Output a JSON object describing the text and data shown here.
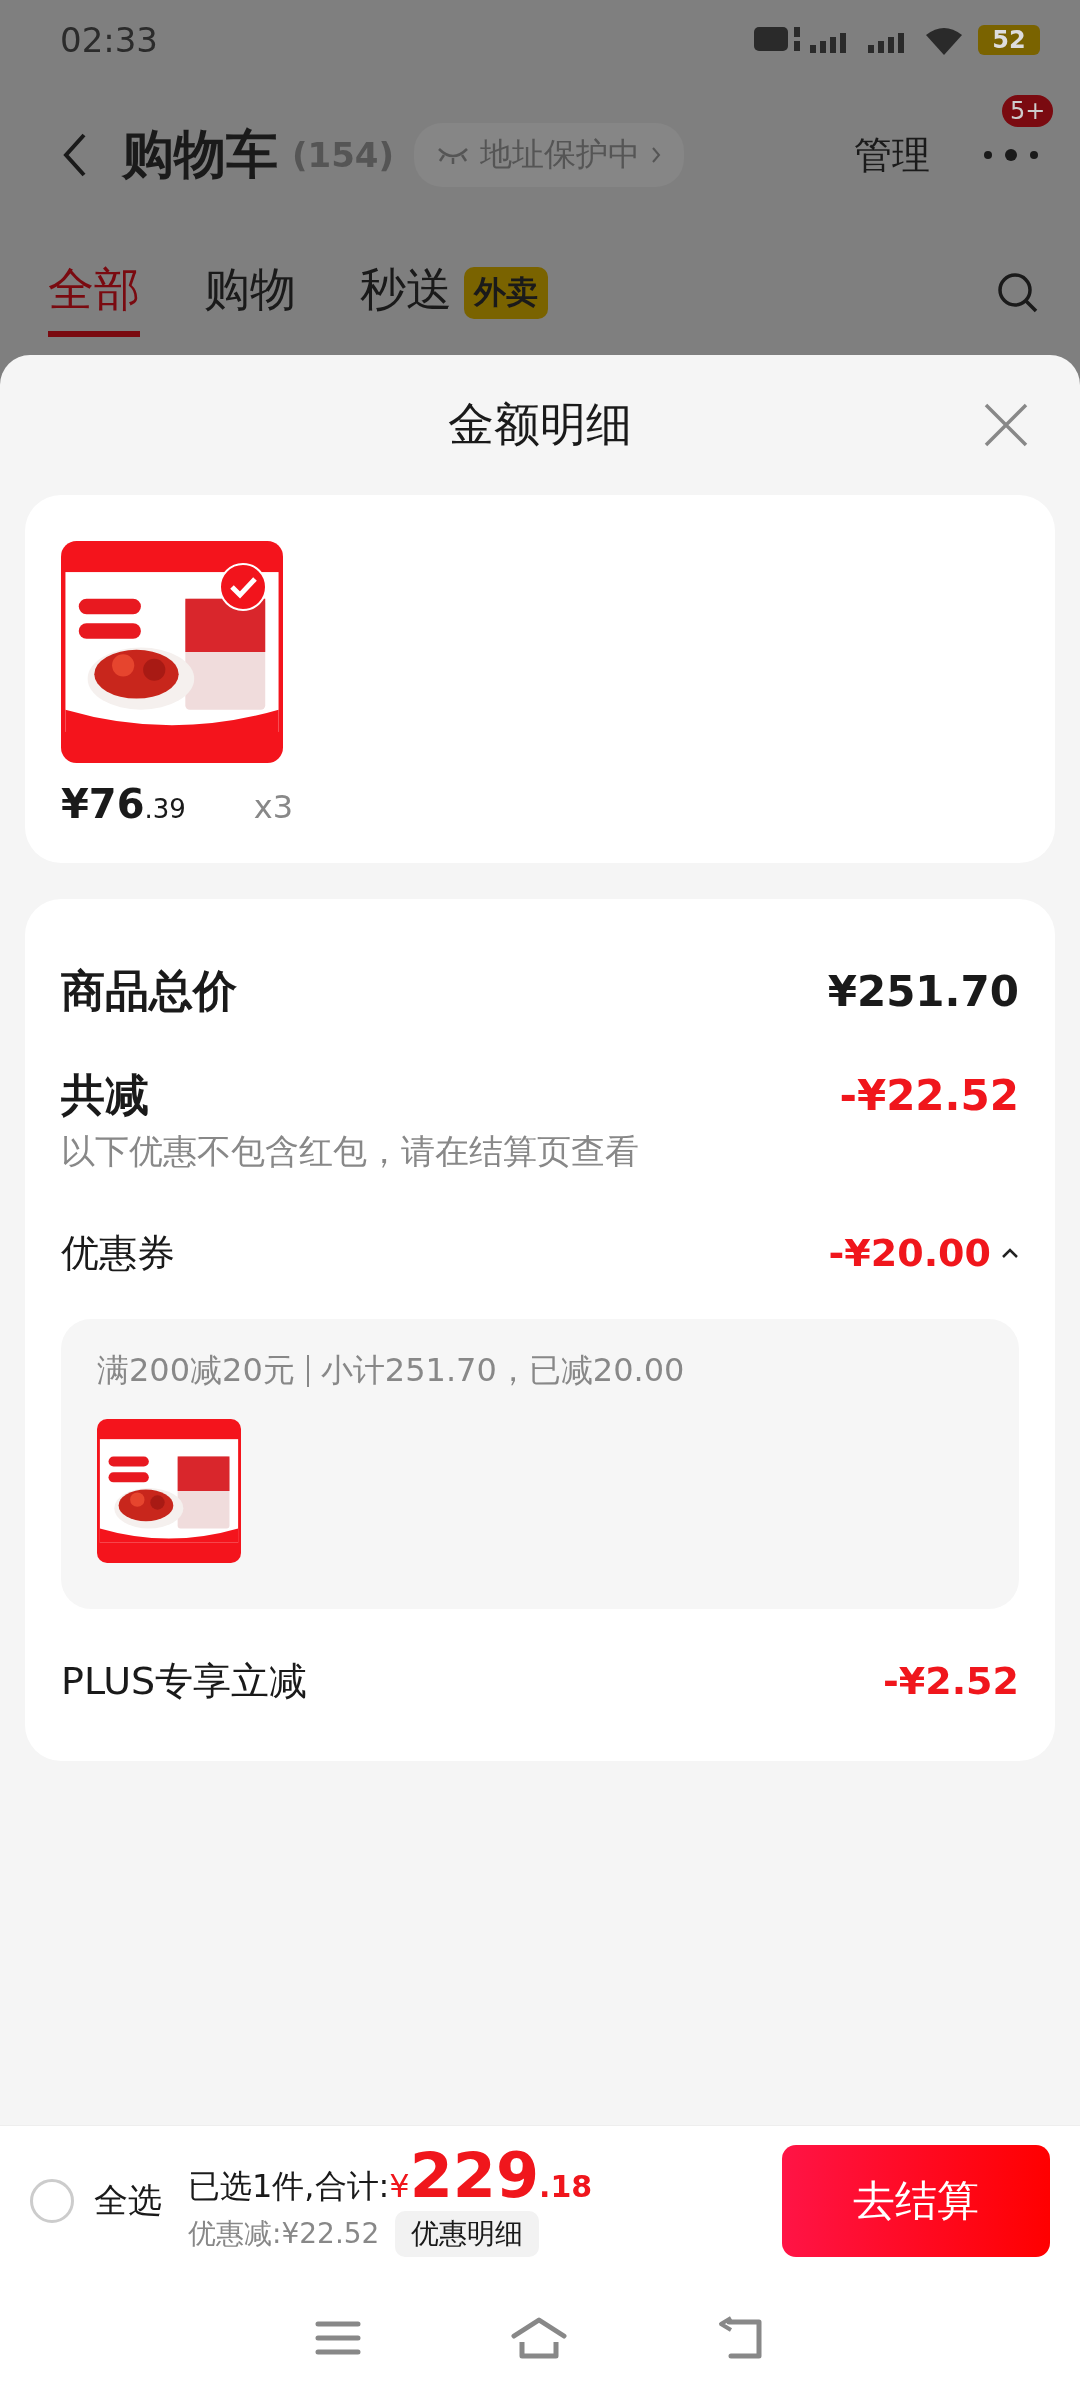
{
  "status_bar": {
    "time": "02:33",
    "battery": "52"
  },
  "header": {
    "title": "购物车",
    "count": "(154)",
    "address_chip": "地址保护中",
    "manage": "管理",
    "badge": "5+"
  },
  "tabs": [
    {
      "label": "全部",
      "selected": true
    },
    {
      "label": "购物",
      "selected": false
    },
    {
      "label": "秒送",
      "selected": false,
      "tag": "外卖"
    }
  ],
  "sheet": {
    "title": "金额明细",
    "products": [
      {
        "checked": true,
        "price": "¥76",
        "price_decimal": ".39",
        "quantity": "x3"
      }
    ],
    "rows": [
      {
        "kind": "total",
        "label": "商品总价",
        "value": "¥251.70"
      },
      {
        "kind": "discount",
        "label": "共减",
        "value": "-¥22.52",
        "note": "以下优惠不包含红包，请在结算页查看"
      },
      {
        "kind": "coupon",
        "label": "优惠券",
        "value": "-¥20.00",
        "expanded": true,
        "rule": "满200减20元",
        "summary": "小计251.70，已减20.00"
      },
      {
        "kind": "plain",
        "label": "PLUS专享立减",
        "value": "-¥2.52"
      }
    ]
  },
  "bottom_bar": {
    "select_all": {
      "label": "全选",
      "checked": false
    },
    "selected_text": "已选1件,合计:",
    "currency": "¥",
    "total": "229",
    "total_decimal": ".18",
    "saving": "优惠减:¥22.52",
    "detail_button": "优惠明细",
    "checkout": "去结算"
  }
}
